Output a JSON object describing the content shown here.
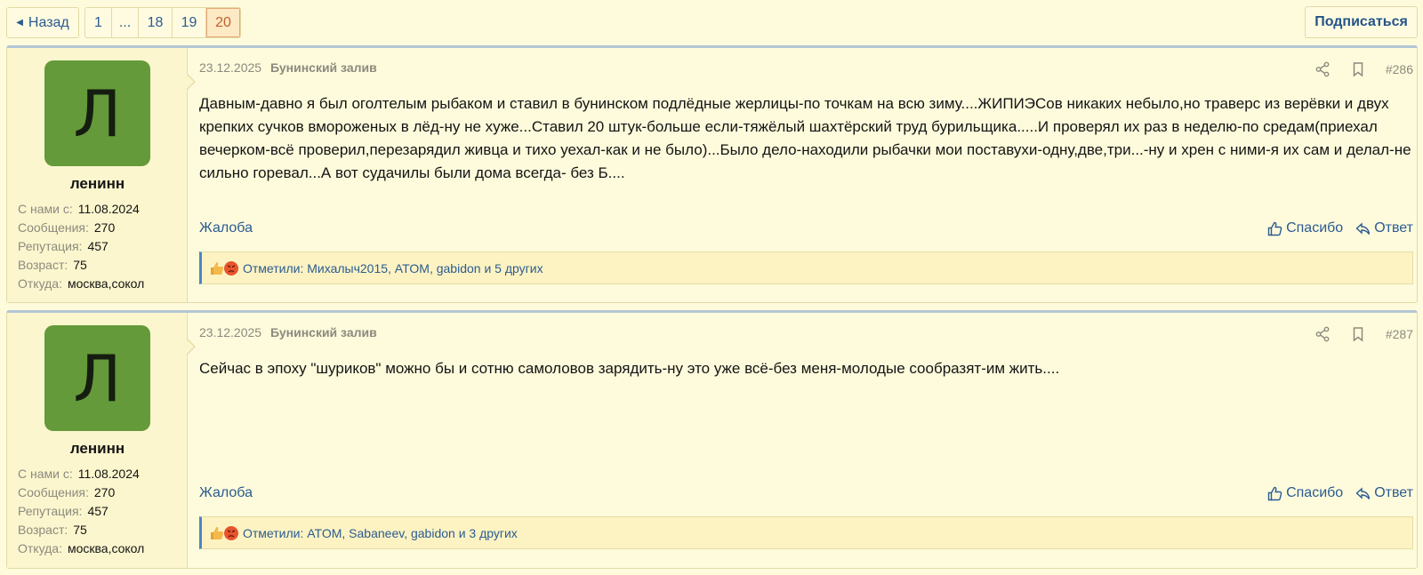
{
  "nav": {
    "back_label": "Назад",
    "pages": [
      "1",
      "...",
      "18",
      "19",
      "20"
    ],
    "current_page": "20",
    "subscribe_label": "Подписаться"
  },
  "posts": [
    {
      "avatar_letter": "Л",
      "username": "ленинн",
      "stats": [
        {
          "key": "С нами с:",
          "value": "11.08.2024"
        },
        {
          "key": "Сообщения:",
          "value": "270"
        },
        {
          "key": "Репутация:",
          "value": "457"
        },
        {
          "key": "Возраст:",
          "value": "75"
        },
        {
          "key": "Откуда:",
          "value": "москва,сокол"
        }
      ],
      "date": "23.12.2025",
      "forum": "Бунинский залив",
      "number": "#286",
      "body": "Давным-давно я был оголтелым рыбаком и ставил в бунинском подлёдные жерлицы-по точкам на всю зиму....ЖИПИЭСов никаких небыло,но траверс из верёвки и двух крепких сучков вмороженых в лёд-ну не хуже...Ставил 20 штук-больше если-тяжёлый шахтёрский труд бурильщика.....И проверял их раз в неделю-по средам(приехал вечерком-всё проверил,перезарядил живца и тихо уехал-как и не было)...Было дело-находили рыбачки мои поставухи-одну,две,три...-ну и хрен с ними-я их сам и делал-не сильно горевал...А вот судачилы были дома всегда- без Б....",
      "complaint_label": "Жалоба",
      "thanks_label": "Спасибо",
      "reply_label": "Ответ",
      "reactions_text": "Отметили: Михалыч2015, ATOM, gabidon и 5 других"
    },
    {
      "avatar_letter": "Л",
      "username": "ленинн",
      "stats": [
        {
          "key": "С нами с:",
          "value": "11.08.2024"
        },
        {
          "key": "Сообщения:",
          "value": "270"
        },
        {
          "key": "Репутация:",
          "value": "457"
        },
        {
          "key": "Возраст:",
          "value": "75"
        },
        {
          "key": "Откуда:",
          "value": "москва,сокол"
        }
      ],
      "date": "23.12.2025",
      "forum": "Бунинский залив",
      "number": "#287",
      "body": "Сейчас в эпоху \"шуриков\" можно бы и сотню самоловов зарядить-ну это уже всё-без меня-молодые сообразят-им жить....",
      "complaint_label": "Жалоба",
      "thanks_label": "Спасибо",
      "reply_label": "Ответ",
      "reactions_text": "Отметили: ATOM, Sabaneev, gabidon и 3 других"
    }
  ],
  "colors": {
    "page_bg": "#fefbdc",
    "link": "#2b5b92",
    "avatar_bg": "#649a3a",
    "reaction_bar_accent": "#4a86c4"
  },
  "icons": [
    "caret-left-icon",
    "share-icon",
    "bookmark-icon",
    "thumbs-up-icon",
    "reply-icon",
    "like-reaction-icon",
    "angry-reaction-icon"
  ]
}
